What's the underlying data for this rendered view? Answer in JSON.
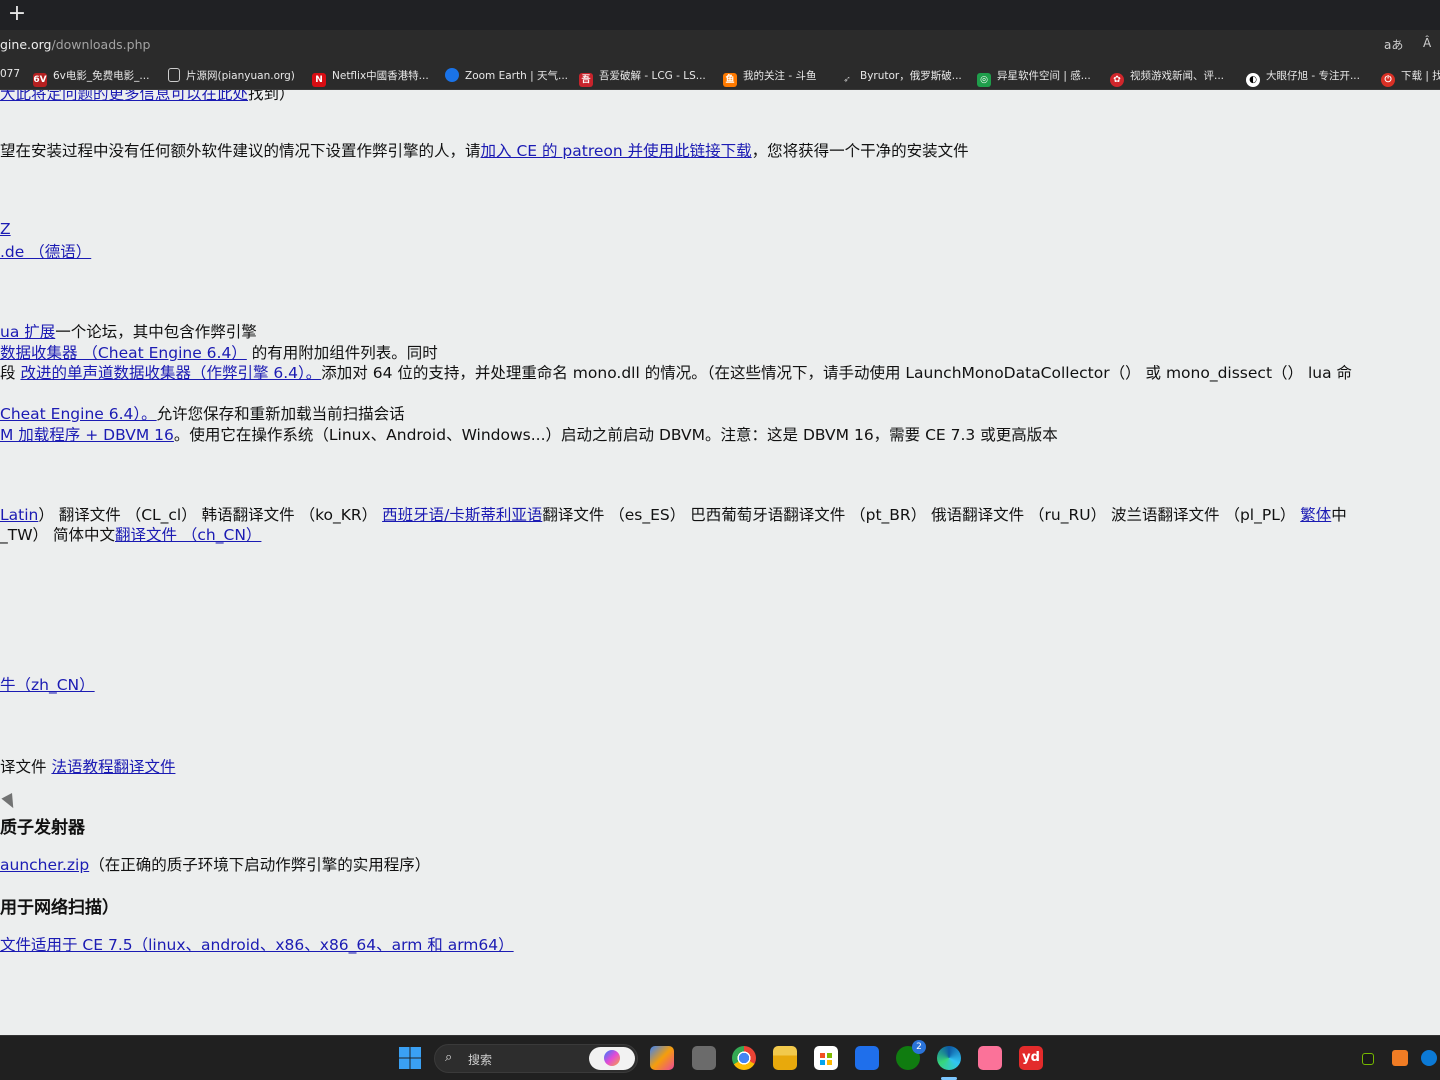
{
  "browser": {
    "new_tab": "+",
    "url_host": "gine.org",
    "url_path": "/downloads.php",
    "translate_icon": "aあ",
    "read_aloud_icon": "Â"
  },
  "bookmarks": [
    {
      "label": "077",
      "icon": "",
      "color": "#2b2b2b"
    },
    {
      "label": "6v电影_免费电影_...",
      "icon": "6V",
      "color": "#b52020"
    },
    {
      "label": "片源网(pianyuan.org)",
      "icon": "▯",
      "color": "#2b2b2b"
    },
    {
      "label": "Netflix中國香港特...",
      "icon": "N",
      "color": "#d80d13"
    },
    {
      "label": "Zoom Earth | 天气...",
      "icon": "●",
      "color": "#1a73e8"
    },
    {
      "label": "吾爱破解 - LCG - LS...",
      "icon": "吾",
      "color": "#c8242c"
    },
    {
      "label": "我的关注 - 斗鱼",
      "icon": "鱼",
      "color": "#ff7a00"
    },
    {
      "label": "Byrutor，俄罗斯破...",
      "icon": "➶",
      "color": "#2b2b2b"
    },
    {
      "label": "异星软件空间 | 感...",
      "icon": "◎",
      "color": "#1f9e4b"
    },
    {
      "label": "视频游戏新闻、评...",
      "icon": "✿",
      "color": "#d0262b"
    },
    {
      "label": "大眼仔旭 - 专注开...",
      "icon": "◐",
      "color": "#222222"
    },
    {
      "label": "下载 | 找",
      "icon": "⏻",
      "color": "#d93025"
    }
  ],
  "content": {
    "l1": {
      "pre": "",
      "link": "大此将定问题的更多信息可以在此处",
      "post": "找到）"
    },
    "l2": {
      "pre": "望在安装过程中没有任何额外软件建议的情况下设置作弊引擎的人，请",
      "link": "加入 CE 的 patreon 并使用此链接下载",
      "post": "，您将获得一个干净的安装文件"
    },
    "l3": {
      "link": "Z"
    },
    "l4": {
      "link": ".de （德语）"
    },
    "l5": {
      "link": "ua 扩展",
      "post": "一个论坛，其中包含作弊引擎"
    },
    "l6": {
      "link": " 数据收集器 （Cheat Engine 6.4）",
      "post": " 的有用附加组件列表。同时"
    },
    "l7": {
      "pre": "段 ",
      "link": "改进的单声道数据收集器（作弊引擎 6.4）。",
      "post": "添加对 64 位的支持，并处理重命名 mono.dll 的情况。（在这些情况下，请手动使用 LaunchMonoDataCollector（） 或 mono_dissect（） lua 命"
    },
    "l8": {
      "link": "Cheat Engine 6.4）。",
      "post": "允许您保存和重新加载当前扫描会话"
    },
    "l9": {
      "link": "M 加载程序 + DBVM 16",
      "post": "。使用它在操作系统（Linux、Android、Windows...）启动之前启动 DBVM。注意：这是 DBVM 16，需要 CE 7.3 或更高版本"
    },
    "l10": {
      "link1": "Latin",
      "mid": "） 翻译文件 （CL_cl） 韩语翻译文件 （ko_KR） ",
      "link2": "西班牙语/卡斯蒂利亚语",
      "post": "翻译文件 （es_ES） 巴西葡萄牙语翻译文件 （pt_BR） 俄语翻译文件 （ru_RU） 波兰语翻译文件 （pl_PL） ",
      "link3": "繁体",
      "post2": "中"
    },
    "l11": {
      "pre": "_TW） 简体中文",
      "link": "翻译文件 （ch_CN）"
    },
    "l12": {
      "link": "牛（zh_CN）"
    },
    "l13": {
      "pre": "译文件 ",
      "link": "法语教程翻译文件"
    },
    "h1": "质子发射器",
    "l14": {
      "link": "auncher.zip",
      "post": "（在正确的质子环境下启动作弊引擎的实用程序）"
    },
    "h2": "用于网络扫描）",
    "l15": {
      "link": "文件适用于 CE 7.5（linux、android、x86、x86_64、arm 和 arm64）"
    }
  },
  "taskbar": {
    "search_placeholder": "搜索",
    "xbox_badge": "2",
    "youdao_label": "yd",
    "apps": [
      "start-icon",
      "copilot-icon",
      "file-manager-icon",
      "chrome-icon",
      "file-explorer-icon",
      "microsoft-store-icon",
      "mail-icon",
      "xbox-icon",
      "edge-icon",
      "bilibili-icon",
      "youdao-icon"
    ]
  },
  "colors": {
    "page_bg": "#eceeee",
    "link": "#1b1bb3",
    "chrome_dark": "#202124"
  }
}
